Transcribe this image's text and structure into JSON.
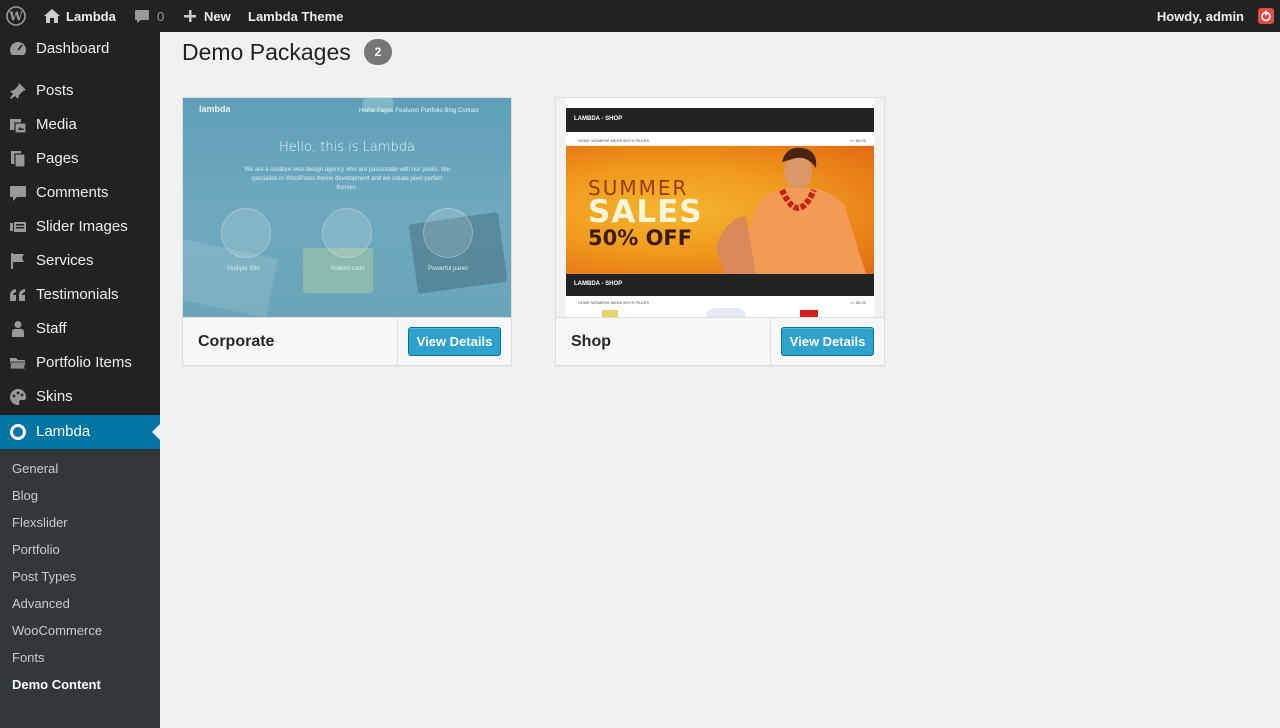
{
  "adminbar": {
    "site_name": "Lambda",
    "comments_count": "0",
    "new_label": "New",
    "theme_label": "Lambda Theme",
    "howdy": "Howdy, admin"
  },
  "sidebar": {
    "items": [
      {
        "label": "Dashboard",
        "icon": "dashboard-icon"
      },
      {
        "label": "Posts",
        "icon": "pin-icon"
      },
      {
        "label": "Media",
        "icon": "media-icon"
      },
      {
        "label": "Pages",
        "icon": "pages-icon"
      },
      {
        "label": "Comments",
        "icon": "comment-icon"
      },
      {
        "label": "Slider Images",
        "icon": "slider-icon"
      },
      {
        "label": "Services",
        "icon": "flag-icon"
      },
      {
        "label": "Testimonials",
        "icon": "quote-icon"
      },
      {
        "label": "Staff",
        "icon": "person-icon"
      },
      {
        "label": "Portfolio Items",
        "icon": "folder-icon"
      },
      {
        "label": "Skins",
        "icon": "palette-icon"
      },
      {
        "label": "Lambda",
        "icon": "circle-icon"
      }
    ],
    "submenu": [
      "General",
      "Blog",
      "Flexslider",
      "Portfolio",
      "Post Types",
      "Advanced",
      "WooCommerce",
      "Fonts",
      "Demo Content"
    ]
  },
  "main": {
    "title": "Demo Packages",
    "count": "2",
    "packages": [
      {
        "name": "Corporate",
        "button": "View Details",
        "preview": {
          "logo": "lambda",
          "nav": "Home   Pages   Features   Portfolio   Blog   Contact",
          "heading": "Hello, this is Lambda",
          "text": "We are a creative web design agency who are passionate with our pixels. We specialise in WordPress theme development and we create pixel perfect themes.",
          "features": [
            "Multiple Site",
            "Robust code",
            "Powerful panel"
          ]
        }
      },
      {
        "name": "Shop",
        "button": "View Details",
        "preview": {
          "logo": "LAMBDA - SHOP",
          "nav": "HOME   WOMENS   MENS   BOYS   PAGES",
          "banner_line1": "SUMMER",
          "banner_line2": "SALES",
          "banner_line3": "50% OFF",
          "cart": "0 / $0.00"
        }
      }
    ]
  },
  "colors": {
    "adminbar_bg": "#222222",
    "menu_current": "#0074a2",
    "button": "#2ea2cc",
    "badge": "#777777"
  }
}
